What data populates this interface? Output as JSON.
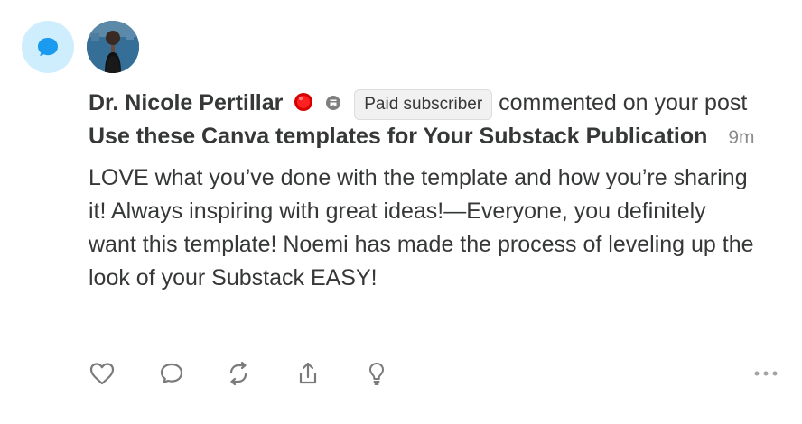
{
  "notification": {
    "type_icon": "chat-bubble-icon",
    "avatar_icon": "user-avatar",
    "author": "Dr. Nicole Pertillar",
    "verified_icon": "red-dot-icon",
    "extra_icon": "substack-icon",
    "badge": "Paid subscriber",
    "action_text": "commented on your post",
    "post_title": "Use these Canva templates for Your Substack Publication",
    "timestamp": "9m",
    "comment": "LOVE what you’ve done with the template and how you’re sharing it! Always inspiring with great ideas!—Everyone, you definitely want this template! Noemi has made the process of leveling up the look of your Substack EASY!"
  },
  "actions": {
    "icons": [
      "heart-icon",
      "comment-icon",
      "restack-icon",
      "share-icon",
      "lightbulb-icon",
      "more-icon"
    ]
  },
  "colors": {
    "badge_bg": "#cfeefd",
    "accent_blue": "#1a9bf0",
    "text": "#363737",
    "muted": "#8b8b8b"
  }
}
